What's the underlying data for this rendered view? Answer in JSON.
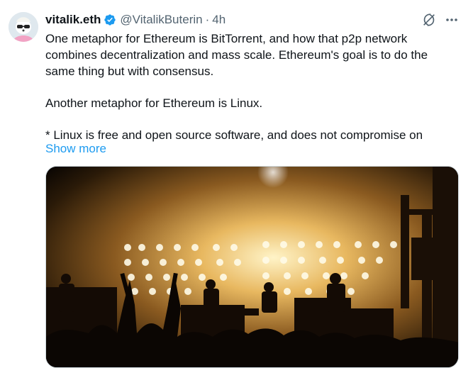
{
  "tweet": {
    "display_name": "vitalik.eth",
    "handle": "@VitalikButerin",
    "separator": "·",
    "time": "4h",
    "paragraphs": [
      "One metaphor for Ethereum is BitTorrent, and how that p2p network combines decentralization and mass scale. Ethereum's goal is to do the same thing but with consensus.",
      "Another metaphor for Ethereum is Linux.",
      "* Linux is free and open source software, and does not compromise on"
    ],
    "show_more": "Show more"
  },
  "icons": {
    "verified": "verified-badge-icon",
    "grok": "grok-icon",
    "more": "more-options-icon"
  },
  "colors": {
    "link": "#1d9bf0",
    "secondary": "#536471",
    "primary_text": "#0f1419"
  }
}
